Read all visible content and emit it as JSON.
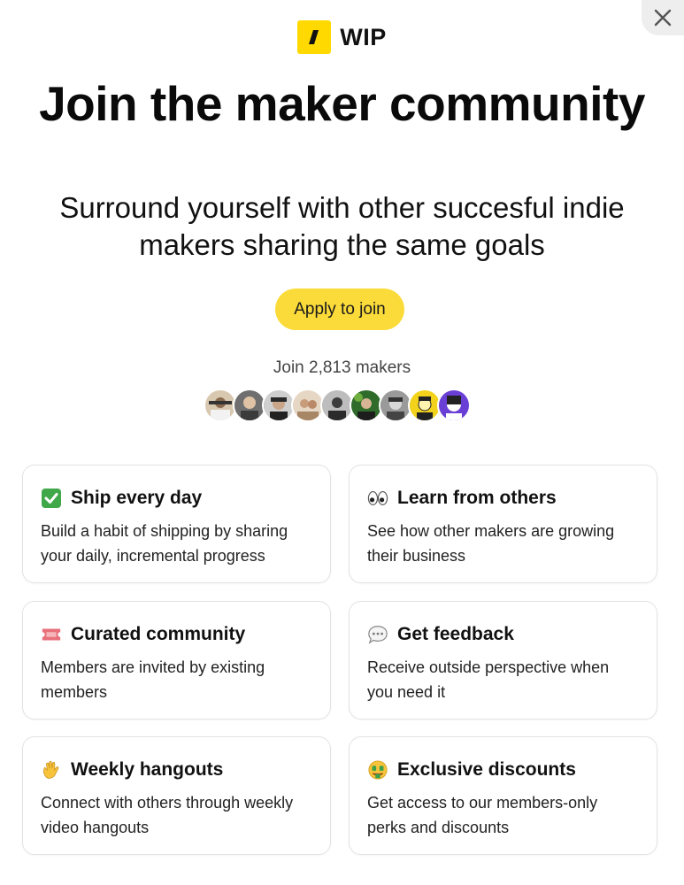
{
  "brand": {
    "name": "WIP",
    "accent": "#ffd900"
  },
  "hero": {
    "title": "Join the maker community",
    "subtitle": "Surround yourself with other succesful indie makers sharing the same goals",
    "cta_label": "Apply to join",
    "cta_color": "#fbdb3a"
  },
  "makers": {
    "count_label": "Join 2,813 makers"
  },
  "features": [
    {
      "emoji": "check-mark-icon",
      "title": "Ship every day",
      "body": "Build a habit of shipping by sharing your daily, incremental progress"
    },
    {
      "emoji": "eyes-icon",
      "title": "Learn from others",
      "body": "See how other makers are growing their business"
    },
    {
      "emoji": "ticket-icon",
      "title": "Curated community",
      "body": "Members are invited by existing members"
    },
    {
      "emoji": "speech-bubble-icon",
      "title": "Get feedback",
      "body": "Receive outside perspective when you need it"
    },
    {
      "emoji": "waving-hand-icon",
      "title": "Weekly hangouts",
      "body": "Connect with others through weekly video hangouts"
    },
    {
      "emoji": "money-face-icon",
      "title": "Exclusive discounts",
      "body": "Get access to our members-only perks and discounts"
    }
  ]
}
